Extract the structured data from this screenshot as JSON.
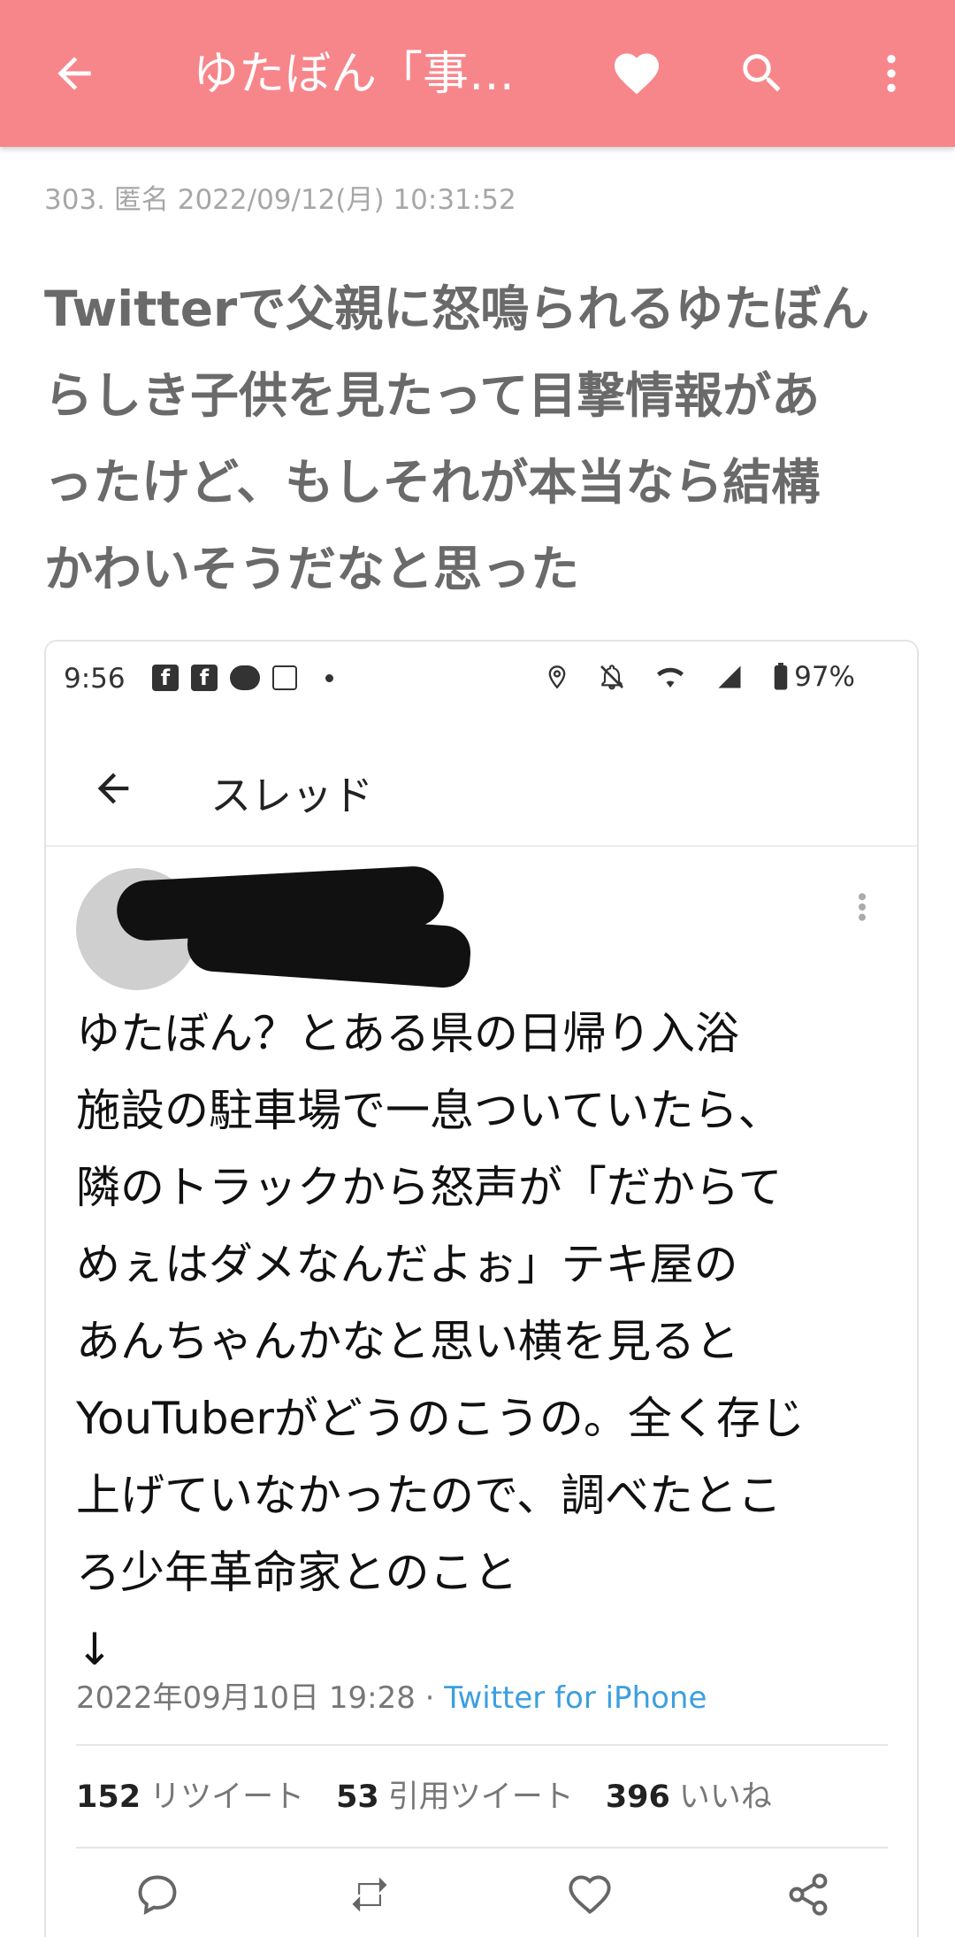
{
  "appbar": {
    "title": "ゆたぼん「事…",
    "color": "#f7868b",
    "icons": [
      "arrow-left-icon",
      "heart-icon",
      "search-icon",
      "more-vert-icon"
    ]
  },
  "post": {
    "meta": "303. 匿名 2022/09/12(月) 10:31:52",
    "lines": [
      "Twitterで父親に怒鳴られるゆたぼん",
      "らしき子供を見たって目撃情報があ",
      "ったけど、もしそれが本当なら結構",
      "かわいそうだなと思った"
    ]
  },
  "screenshot": {
    "status_bar": {
      "time": "9:56",
      "battery": "97%",
      "icons": [
        "facebook-icon",
        "facebook-icon",
        "line-icon",
        "d-icon",
        "dot-icon",
        "location-icon",
        "mute-icon",
        "wifi-icon",
        "signal-icon",
        "battery-icon"
      ]
    },
    "thread_header": {
      "title": "スレッド"
    },
    "tweet": {
      "lines": [
        "ゆたぼん？とある県の日帰り入浴",
        "施設の駐車場で一息ついていたら、",
        "隣のトラックから怒声が「だからて",
        "めぇはダメなんだよぉ」テキ屋の",
        "あんちゃんかなと思い横を見ると",
        "YouTuberがどうのこうの。全く存じ",
        "上げていなかったので、調べたとこ",
        "ろ少年革命家とのこと",
        "↓"
      ],
      "date": "2022年09月10日 19:28",
      "source": "Twitter for iPhone",
      "source_color": "#3b9fe0",
      "retweets_count": "152",
      "retweets_label": "リツイート",
      "quotes_count": "53",
      "quotes_label": "引用ツイート",
      "likes_count": "396",
      "likes_label": "いいね"
    }
  }
}
